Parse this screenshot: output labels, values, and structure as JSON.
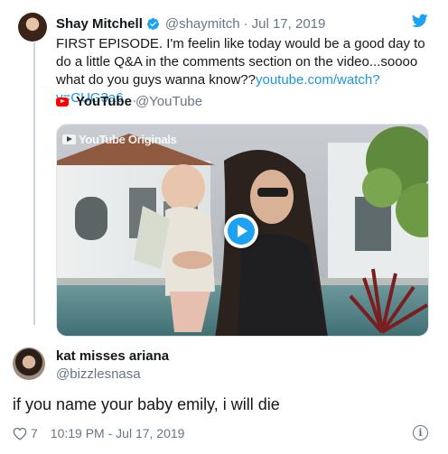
{
  "original_tweet": {
    "author_name": "Shay Mitchell",
    "handle": "@shaymitch",
    "separator": "·",
    "date": "Jul 17, 2019",
    "verified": true,
    "text": "FIRST EPISODE. I'm feelin like today would be a good day to do a little Q&A in the comments section on the video...soooo what do you guys wanna know??",
    "link_text": "youtube.com/watch?v=CUG3a6…",
    "icons": {
      "avatar": "avatar-photo",
      "verified": "verified-badge-icon",
      "brand": "twitter-bird-icon"
    }
  },
  "quoted_source": {
    "name": "YouTube",
    "handle": "@YouTube",
    "icon": "youtube-logo-icon",
    "media": {
      "overlay_text": "YouTube Originals",
      "play_icon": "play-icon"
    }
  },
  "reply": {
    "author_name": "kat misses ariana",
    "handle": "@bizzlesnasa",
    "text": "if you name your baby emily, i will die",
    "likes": "7",
    "timestamp": "10:19 PM - Jul 17, 2019",
    "icons": {
      "like": "heart-icon",
      "info": "info-icon"
    }
  },
  "colors": {
    "link": "#1b95e0",
    "twitter_blue": "#1da1f2",
    "muted": "#657786",
    "text": "#14171a",
    "thread_line": "#ccd6dd",
    "youtube_red": "#ff0000"
  }
}
